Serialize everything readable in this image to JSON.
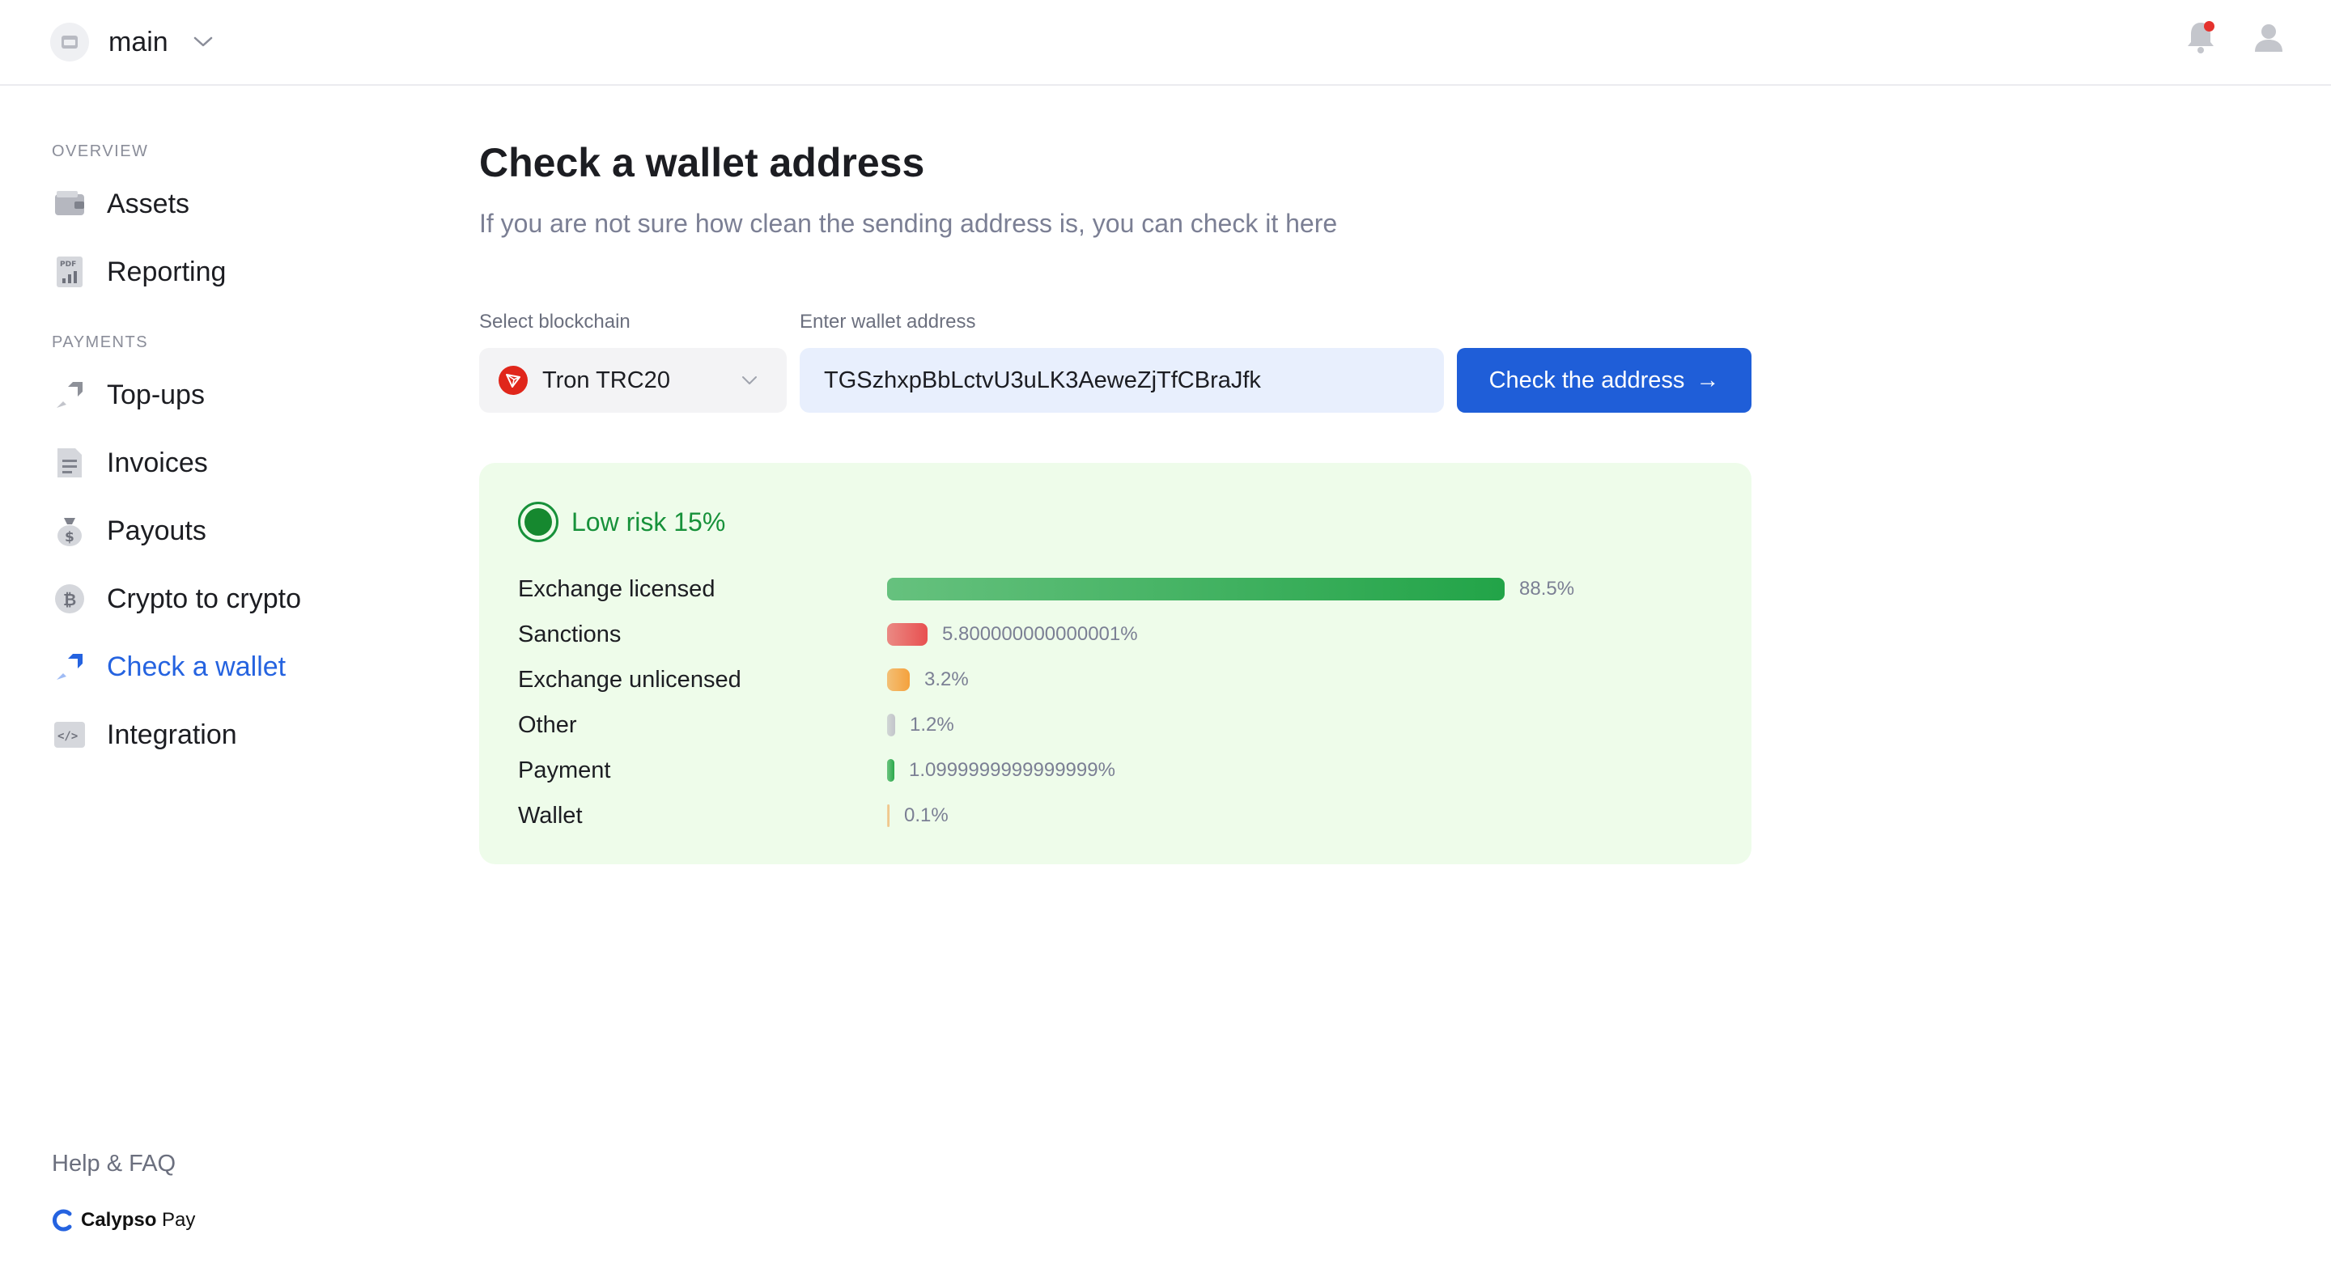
{
  "header": {
    "workspace": "main"
  },
  "sidebar": {
    "sections": [
      {
        "title": "OVERVIEW",
        "items": [
          {
            "label": "Assets",
            "icon": "wallet-icon"
          },
          {
            "label": "Reporting",
            "icon": "pdf-report-icon"
          }
        ]
      },
      {
        "title": "PAYMENTS",
        "items": [
          {
            "label": "Top-ups",
            "icon": "arrow-in-icon"
          },
          {
            "label": "Invoices",
            "icon": "document-icon"
          },
          {
            "label": "Payouts",
            "icon": "money-bag-icon"
          },
          {
            "label": "Crypto to crypto",
            "icon": "bitcoin-icon"
          },
          {
            "label": "Check a wallet",
            "icon": "check-wallet-icon",
            "active": true
          },
          {
            "label": "Integration",
            "icon": "code-icon"
          }
        ]
      }
    ],
    "help": "Help & FAQ",
    "brand": {
      "strong": "Calypso",
      "light": " Pay"
    }
  },
  "main": {
    "title": "Check a wallet address",
    "subtitle": "If you are not sure how clean the sending address is, you can check it here",
    "form": {
      "blockchain_label": "Select blockchain",
      "blockchain_value": "Tron TRC20",
      "address_label": "Enter wallet address",
      "address_value": "TGSzhxpBbLctvU3uLK3AeweZjTfCBraJfk",
      "button_label": "Check the address",
      "button_arrow": "→"
    },
    "result": {
      "risk_label": "Low risk 15%",
      "rows": [
        {
          "label": "Exchange licensed",
          "value": "88.5%",
          "percent": 88.5,
          "color": "#22a448"
        },
        {
          "label": "Sanctions",
          "value": "5.800000000000001%",
          "percent": 5.8,
          "color": "#e85050"
        },
        {
          "label": "Exchange unlicensed",
          "value": "3.2%",
          "percent": 3.2,
          "color": "#f5a13c"
        },
        {
          "label": "Other",
          "value": "1.2%",
          "percent": 1.2,
          "color": "#c2c4ca"
        },
        {
          "label": "Payment",
          "value": "1.0999999999999999%",
          "percent": 1.1,
          "color": "#2aa84a"
        },
        {
          "label": "Wallet",
          "value": "0.1%",
          "percent": 0.1,
          "color": "#f0c080"
        }
      ]
    }
  },
  "colors": {
    "accent": "#1f5ed8",
    "active_nav": "#2563e0",
    "low_risk": "#17913a",
    "result_bg": "#eefcea",
    "notification": "#e5322d"
  }
}
